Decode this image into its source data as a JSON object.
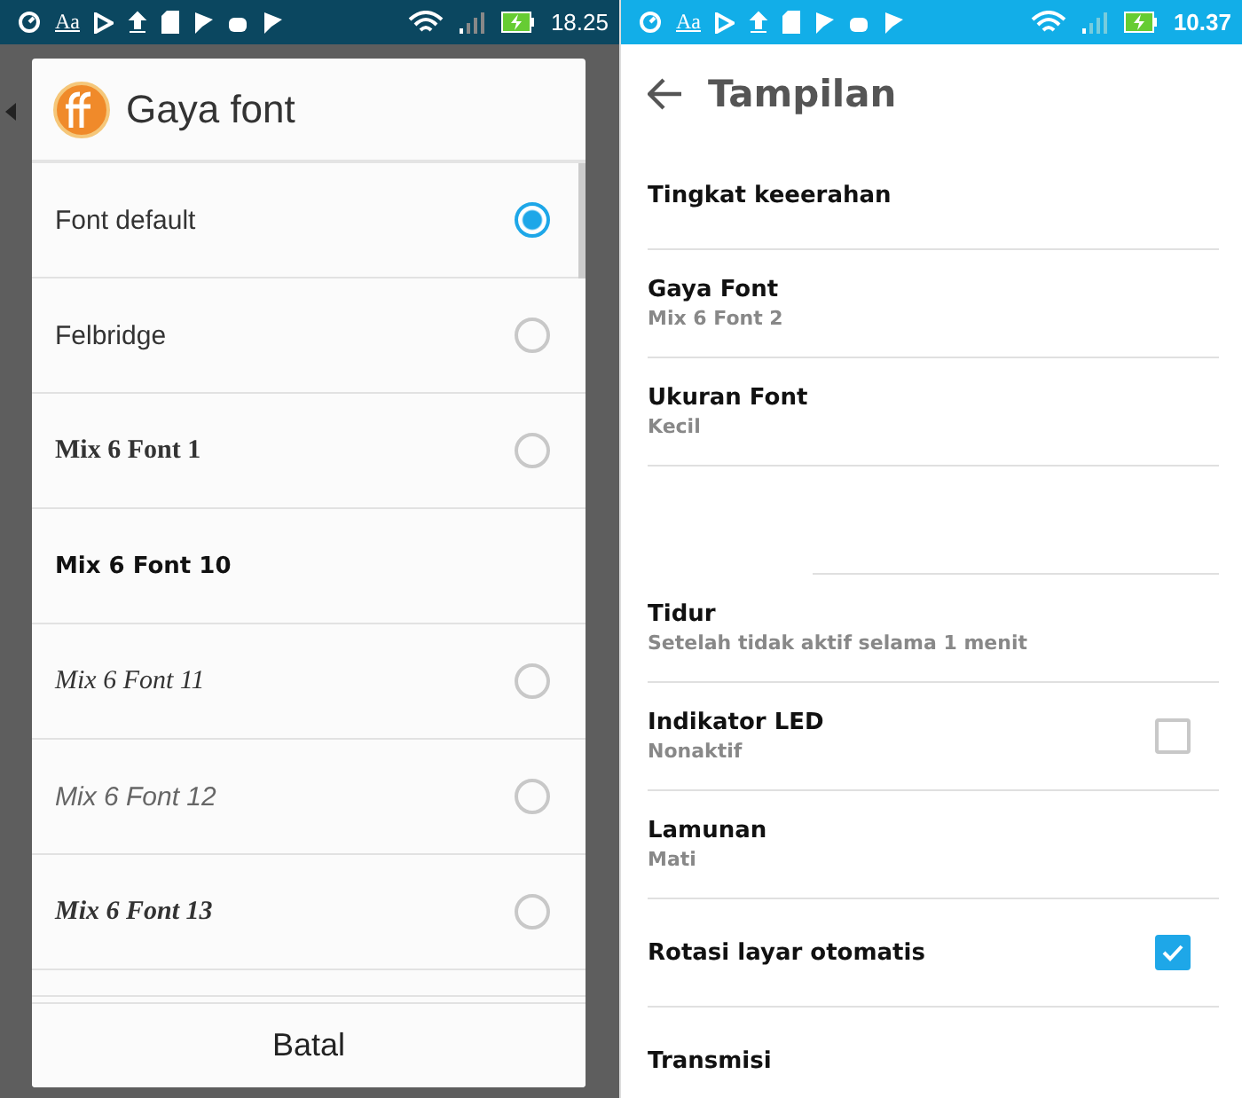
{
  "left_screen": {
    "status_bar": {
      "text_icon": "Aa",
      "time": "18.25"
    },
    "dialog": {
      "title": "Gaya font",
      "options": [
        {
          "label": "Font default",
          "kind": "sans",
          "selected": true
        },
        {
          "label": "Felbridge",
          "kind": "sans",
          "selected": false
        },
        {
          "label": "Mix 6 Font 1",
          "kind": "serif",
          "selected": false
        },
        {
          "label": "Mix 6 Font 10",
          "kind": "bold"
        },
        {
          "label": "Mix 6 Font 11",
          "kind": "script",
          "selected": false
        },
        {
          "label": "Mix 6 Font 12",
          "kind": "light",
          "selected": false
        },
        {
          "label": "Mix 6 Font 13",
          "kind": "bolditalic",
          "selected": false
        }
      ],
      "cancel_button": "Batal"
    }
  },
  "right_screen": {
    "status_bar": {
      "text_icon": "Aa",
      "time": "10.37"
    },
    "title": "Tampilan",
    "settings": [
      {
        "kind": "plain",
        "title": "Tingkat keeerahan"
      },
      {
        "kind": "plain",
        "title": "Gaya Font",
        "summary": "Mix 6 Font 2"
      },
      {
        "kind": "plain",
        "title": "Ukuran Font",
        "summary": "Kecil"
      },
      {
        "kind": "gap"
      },
      {
        "kind": "plain",
        "title": "Tidur",
        "summary": "Setelah tidak aktif selama 1 menit"
      },
      {
        "kind": "checkbox",
        "title": "Indikator LED",
        "summary": "Nonaktif",
        "checked": false
      },
      {
        "kind": "plain",
        "title": "Lamunan",
        "summary": "Mati"
      },
      {
        "kind": "checkbox",
        "title": "Rotasi layar otomatis",
        "checked": true
      },
      {
        "kind": "plain",
        "title": "Transmisi"
      }
    ]
  }
}
